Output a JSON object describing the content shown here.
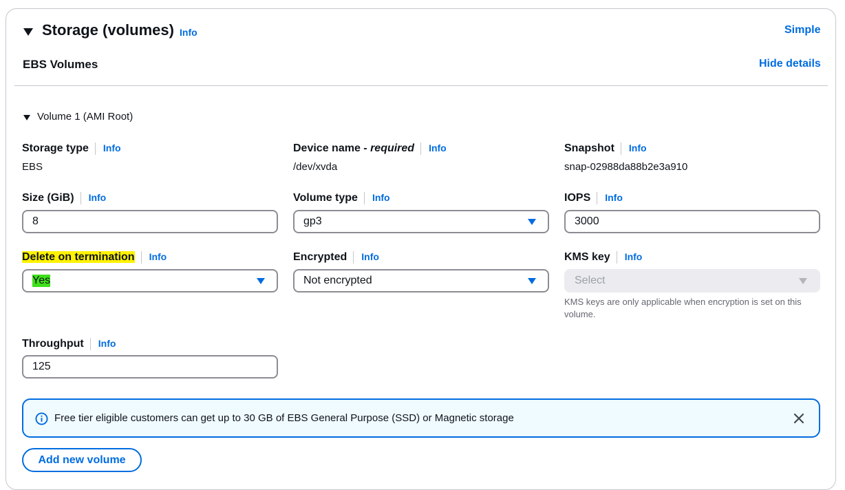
{
  "header": {
    "title": "Storage (volumes)",
    "info": "Info",
    "simple_link": "Simple"
  },
  "ebs": {
    "title": "EBS Volumes",
    "hide_details": "Hide details"
  },
  "volume": {
    "title": "Volume 1 (AMI Root)",
    "storage_type": {
      "label": "Storage type",
      "info": "Info",
      "value": "EBS"
    },
    "device_name": {
      "label": "Device name - ",
      "required": "required",
      "info": "Info",
      "value": "/dev/xvda"
    },
    "snapshot": {
      "label": "Snapshot",
      "info": "Info",
      "value": "snap-02988da88b2e3a910"
    },
    "size": {
      "label": "Size (GiB)",
      "info": "Info",
      "value": "8"
    },
    "volume_type": {
      "label": "Volume type",
      "info": "Info",
      "value": "gp3"
    },
    "iops": {
      "label": "IOPS",
      "info": "Info",
      "value": "3000"
    },
    "delete_on_termination": {
      "label": "Delete on termination",
      "info": "Info",
      "value": "Yes"
    },
    "encrypted": {
      "label": "Encrypted",
      "info": "Info",
      "value": "Not encrypted"
    },
    "kms_key": {
      "label": "KMS key",
      "info": "Info",
      "placeholder": "Select",
      "hint_line1": "KMS keys are only applicable when encryption is set on this",
      "hint_line2": "volume."
    },
    "throughput": {
      "label": "Throughput",
      "info": "Info",
      "value": "125"
    }
  },
  "alert": {
    "text": "Free tier eligible customers can get up to 30 GB of EBS General Purpose (SSD) or Magnetic storage"
  },
  "add_volume_button": "Add new volume",
  "colors": {
    "link": "#006ce0",
    "alert_border": "#006ce0",
    "alert_bg": "#f0fbff",
    "highlight_yellow": "#fff200",
    "highlight_green": "#3fdf1c"
  }
}
